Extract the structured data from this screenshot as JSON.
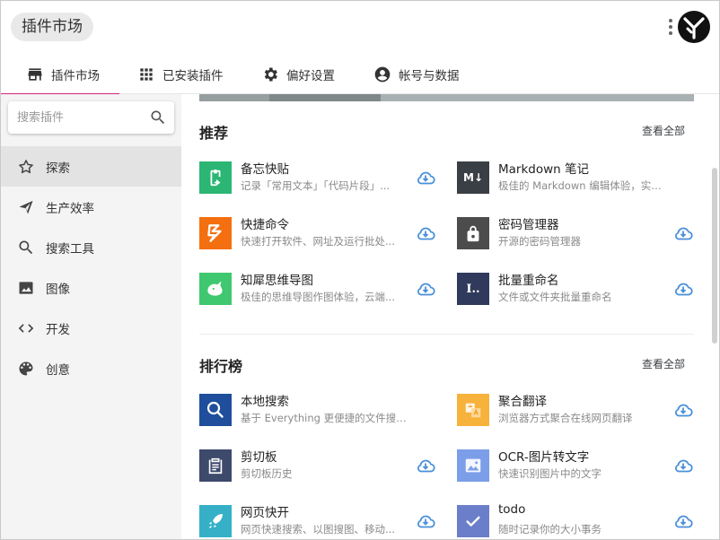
{
  "header": {
    "title": "插件市场"
  },
  "tabs": [
    {
      "label": "插件市场",
      "icon": "store-icon"
    },
    {
      "label": "已安装插件",
      "icon": "grid-icon"
    },
    {
      "label": "偏好设置",
      "icon": "gear-icon"
    },
    {
      "label": "帐号与数据",
      "icon": "account-icon"
    }
  ],
  "sidebar": {
    "search_placeholder": "搜索插件",
    "items": [
      {
        "label": "探索",
        "icon": "star-icon"
      },
      {
        "label": "生产效率",
        "icon": "send-icon"
      },
      {
        "label": "搜索工具",
        "icon": "search-icon"
      },
      {
        "label": "图像",
        "icon": "image-icon"
      },
      {
        "label": "开发",
        "icon": "code-icon"
      },
      {
        "label": "创意",
        "icon": "palette-icon"
      }
    ]
  },
  "sections": {
    "recommend": {
      "title": "推荐",
      "view_all": "查看全部",
      "plugins": [
        {
          "name": "备忘快贴",
          "desc": "记录「常用文本」「代码片段」...",
          "color": "#2bb673"
        },
        {
          "name": "Markdown 笔记",
          "desc": "极佳的 Markdown 编辑体验，实时...",
          "color": "#3a3f45",
          "glyph": "M↓"
        },
        {
          "name": "快捷命令",
          "desc": "快速打开软件、网址及运行批处...",
          "color": "#f36f10"
        },
        {
          "name": "密码管理器",
          "desc": "开源的密码管理器",
          "color": "#4c4c4c"
        },
        {
          "name": "知犀思维导图",
          "desc": "极佳的思维导图作图体验，云端...",
          "color": "#3fc86f"
        },
        {
          "name": "批量重命名",
          "desc": "文件或文件夹批量重命名",
          "color": "#2f3a5c",
          "glyph": "I.."
        }
      ]
    },
    "ranking": {
      "title": "排行榜",
      "view_all": "查看全部",
      "plugins": [
        {
          "name": "本地搜索",
          "desc": "基于 Everything 更便捷的文件搜索...",
          "color": "#1e4e9c"
        },
        {
          "name": "聚合翻译",
          "desc": "浏览器方式聚合在线网页翻译",
          "color": "#f7b23b"
        },
        {
          "name": "剪切板",
          "desc": "剪切板历史",
          "color": "#3e4a6b"
        },
        {
          "name": "OCR-图片转文字",
          "desc": "快速识别图片中的文字",
          "color": "#7c9ee8"
        },
        {
          "name": "网页快开",
          "desc": "网页快速搜索、以图搜图、移动...",
          "color": "#35b0c7"
        },
        {
          "name": "todo",
          "desc": "随时记录你的大小事务",
          "color": "#6b7ec9"
        }
      ]
    }
  },
  "colors": {
    "accent": "#d3247a",
    "download": "#4a90d9"
  }
}
